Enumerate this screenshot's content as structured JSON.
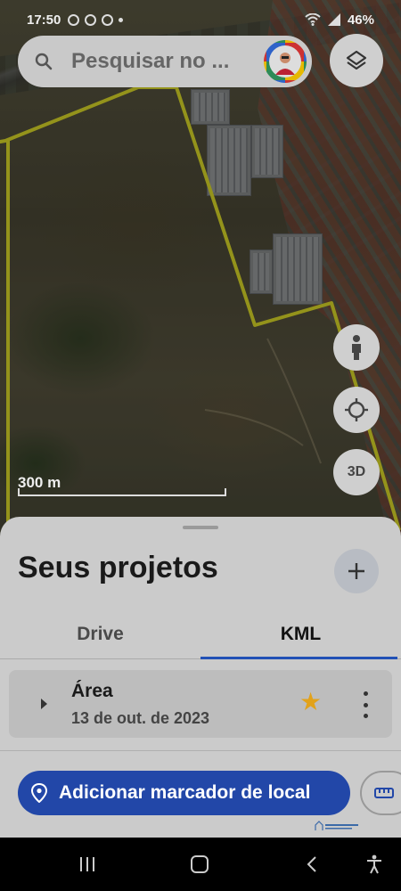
{
  "status_bar": {
    "time": "17:50",
    "battery": "46%"
  },
  "search": {
    "placeholder": "Pesquisar no ..."
  },
  "map": {
    "scale_label": "300 m",
    "boundary_color": "#e4e22a",
    "buttons": {
      "street_view_icon": "person-icon",
      "locate_icon": "crosshair-icon",
      "view_3d_label": "3D"
    }
  },
  "sheet": {
    "title": "Seus projetos",
    "tabs": [
      {
        "label": "Drive",
        "active": false
      },
      {
        "label": "KML",
        "active": true
      }
    ],
    "projects": [
      {
        "title": "Área",
        "date": "13 de out. de 2023",
        "starred": true
      }
    ],
    "add_place_label": "Adicionar marcador de local",
    "accent_color": "#2247a8",
    "star_color": "#e2a21a"
  },
  "nav_bar": {
    "icons": [
      "recents-icon",
      "home-icon",
      "back-icon",
      "accessibility-icon"
    ]
  }
}
